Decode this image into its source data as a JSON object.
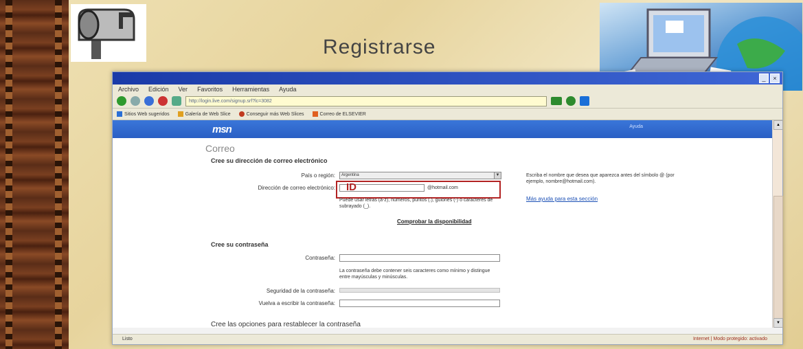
{
  "slide": {
    "title": "Registrarse"
  },
  "browser": {
    "menu": [
      "Archivo",
      "Edición",
      "Ver",
      "Favoritos",
      "Herramientas",
      "Ayuda"
    ],
    "window_controls": [
      "_",
      "×"
    ],
    "address": "http://login.live.com/signup.srf?lc=3082",
    "links": [
      {
        "label": "Sitios Web sugeridos",
        "color": "#2a6fd6"
      },
      {
        "label": "Galería de Web Slice",
        "color": "#e0a020"
      },
      {
        "label": "Conseguir más Web Slices",
        "color": "#c03a20"
      },
      {
        "label": "Correo de ELSEVIER",
        "color": "#e06020"
      }
    ],
    "status_left": "Listo",
    "status_right": "Internet | Modo protegido: activado"
  },
  "page": {
    "brand": "msn",
    "brand_right": "Ayuda",
    "section": "Correo",
    "email_heading": "Cree su dirección de correo electrónico",
    "country_label": "País o región:",
    "country_value": "Argentina",
    "email_label": "Dirección de correo electrónico:",
    "email_domain": "@hotmail.com",
    "email_hint": "Puede usar letras (a-z), números, puntos (.), guiones (-) o caracteres de subrayado (_).",
    "right_help": "Escriba el nombre que desea que aparezca antes del símbolo @ (por ejemplo, nombre@hotmail.com).",
    "right_link": "Más ayuda para esta sección",
    "check_link": "Comprobar la disponibilidad",
    "password_heading": "Cree su contraseña",
    "password_label": "Contraseña:",
    "password_hint": "La contraseña debe contener seis caracteres como mínimo y distingue entre mayúsculas y minúsculas.",
    "strength_label": "Seguridad de la contraseña:",
    "retype_label": "Vuelva a escribir la contraseña:",
    "options_heading": "Cree las opciones para restablecer la contraseña",
    "cursor_mark": "ID"
  },
  "colors": {
    "msn_bar": "#2a5fc4",
    "highlight": "#b22222",
    "link": "#1a4fb5"
  }
}
